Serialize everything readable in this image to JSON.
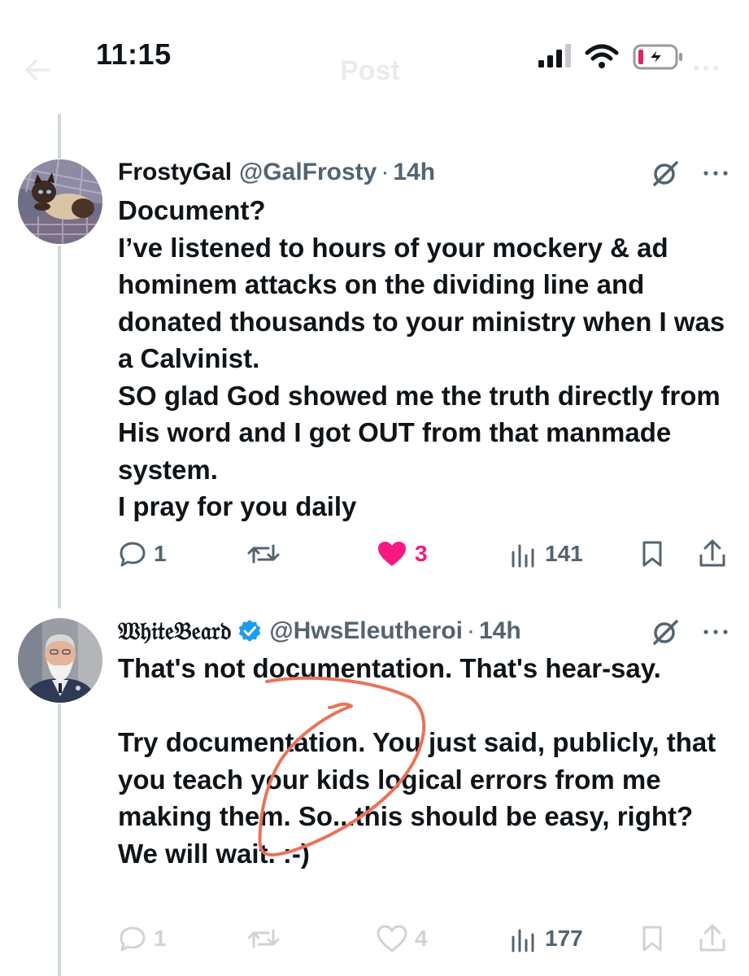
{
  "status_bar": {
    "time": "11:15",
    "battery_color": "#e0245e"
  },
  "nav": {
    "title": "Post"
  },
  "tweets": [
    {
      "name": "FrostyGal",
      "handle": "@GalFrosty",
      "separator": "·",
      "age": "14h",
      "lines": [
        "Document?",
        "I’ve listened to hours of your mockery  &  ad hominem attacks on the dividing line and donated thousands to your ministry when I was a Calvinist.",
        "SO glad God showed me the truth directly from His word and I got OUT from that manmade system.",
        "I pray for you daily"
      ],
      "stats": {
        "replies": "1",
        "reposts": "",
        "likes": "3",
        "views": "141"
      },
      "liked": true
    },
    {
      "name": "𝔚𝔥𝔦𝔱𝔢𝔅𝔢𝔞𝔯𝔡",
      "handle": "@HwsEleutheroi",
      "separator": "·",
      "age": "14h",
      "verified": true,
      "lines": [
        "That's not documentation.  That's hear-say.",
        "",
        "Try documentation.  You just said, publicly, that you teach your kids logical errors from me making them.  So...this should be easy, right?  We will wait.  :-)"
      ],
      "stats": {
        "replies": "1",
        "reposts": "",
        "likes": "4",
        "views": "177"
      },
      "liked": false
    }
  ],
  "colors": {
    "like": "#f91880",
    "verified": "#1d9bf0",
    "annotation": "#e8735a",
    "muted": "#536471"
  }
}
